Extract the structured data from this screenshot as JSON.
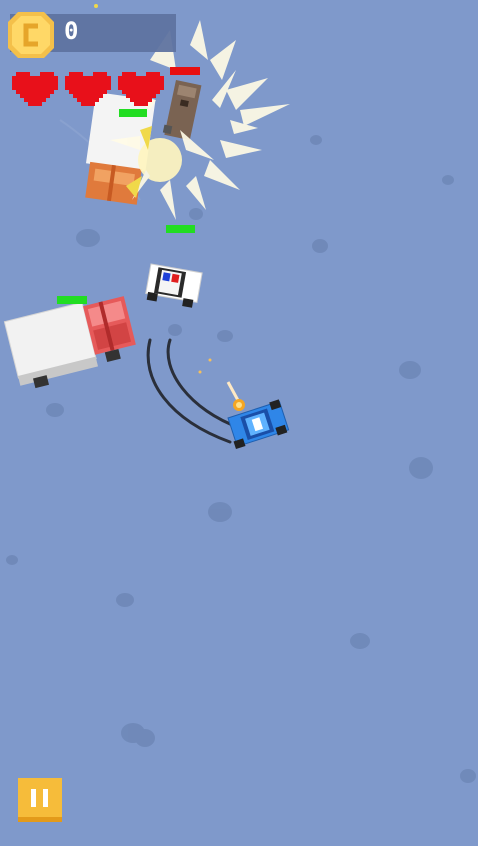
{
  "hud": {
    "coins": "0",
    "lives": 3,
    "pause_icon": "pause-icon",
    "coin_icon": "coin-icon",
    "heart_icon": "heart-icon"
  },
  "colors": {
    "ground": "#7f99cb",
    "heart": "#e8101a",
    "coin": "#f4c04a",
    "pause_button": "#f6bc3a",
    "health_ok": "#22dd22",
    "health_low": "#e81010"
  },
  "entities": [
    {
      "name": "player-police-car",
      "health": 1
    },
    {
      "name": "enemy-police-car",
      "health": 1
    },
    {
      "name": "enemy-delivery-truck",
      "health": 1
    },
    {
      "name": "enemy-truck-exploding",
      "health": 1
    },
    {
      "name": "enemy-tower-turret",
      "health": 0.2
    }
  ]
}
